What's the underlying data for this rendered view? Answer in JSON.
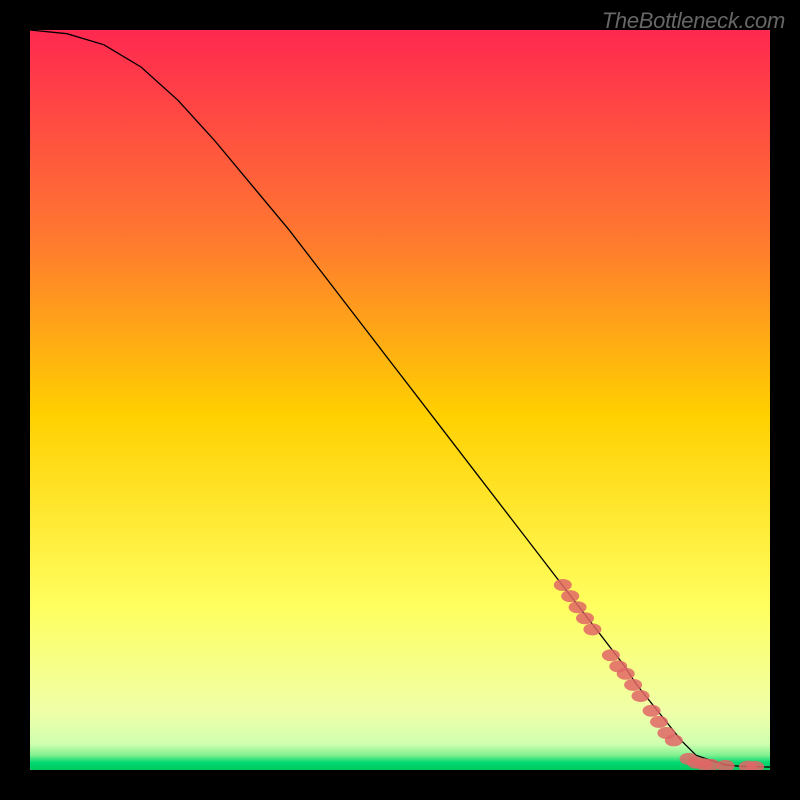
{
  "watermark": "TheBottleneck.com",
  "chart_data": {
    "type": "line",
    "title": "",
    "xlabel": "",
    "ylabel": "",
    "xlim": [
      0,
      100
    ],
    "ylim": [
      0,
      100
    ],
    "curve": {
      "x": [
        0,
        5,
        10,
        15,
        20,
        25,
        30,
        35,
        40,
        45,
        50,
        55,
        60,
        65,
        70,
        75,
        80,
        82,
        84,
        86,
        88,
        90,
        92,
        94,
        96,
        98,
        100
      ],
      "y": [
        100,
        99.5,
        98,
        95,
        90.5,
        85,
        79,
        73,
        66.5,
        60,
        53.5,
        47,
        40.5,
        34,
        27.5,
        21,
        14.5,
        11.5,
        9,
        6.5,
        4,
        2,
        1.3,
        0.7,
        0.5,
        0.45,
        0.4
      ]
    },
    "markers": [
      {
        "x": 72,
        "y": 25
      },
      {
        "x": 73,
        "y": 23.5
      },
      {
        "x": 74,
        "y": 22
      },
      {
        "x": 75,
        "y": 20.5
      },
      {
        "x": 76,
        "y": 19
      },
      {
        "x": 78.5,
        "y": 15.5
      },
      {
        "x": 79.5,
        "y": 14
      },
      {
        "x": 80.5,
        "y": 13
      },
      {
        "x": 81.5,
        "y": 11.5
      },
      {
        "x": 82.5,
        "y": 10
      },
      {
        "x": 84,
        "y": 8
      },
      {
        "x": 85,
        "y": 6.5
      },
      {
        "x": 86,
        "y": 5
      },
      {
        "x": 87,
        "y": 4
      },
      {
        "x": 89,
        "y": 1.5
      },
      {
        "x": 90,
        "y": 1
      },
      {
        "x": 91,
        "y": 0.8
      },
      {
        "x": 92,
        "y": 0.7
      },
      {
        "x": 94,
        "y": 0.55
      },
      {
        "x": 97,
        "y": 0.45
      },
      {
        "x": 98,
        "y": 0.42
      }
    ],
    "gradient_colors": {
      "top": "#ff2850",
      "mid_top": "#ff7830",
      "mid": "#ffd000",
      "mid_low": "#ffff60",
      "low": "#f0ffa8",
      "bottom_edge": "#00d870"
    }
  }
}
